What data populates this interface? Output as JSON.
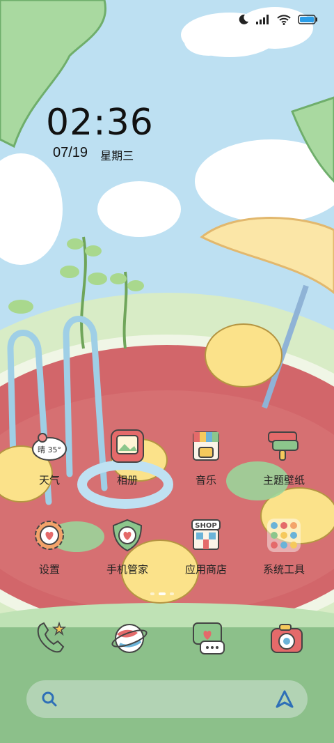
{
  "status_bar": {
    "icons": [
      "moon-icon",
      "signal-icon",
      "wifi-icon",
      "battery-icon"
    ]
  },
  "clock": {
    "time": "02:36",
    "date": "07/19",
    "weekday": "星期三"
  },
  "weather_widget": {
    "text": "晴 35°"
  },
  "apps": [
    {
      "name": "天气",
      "icon": "weather-icon"
    },
    {
      "name": "相册",
      "icon": "gallery-icon"
    },
    {
      "name": "音乐",
      "icon": "music-icon"
    },
    {
      "name": "主题壁纸",
      "icon": "theme-icon"
    },
    {
      "name": "设置",
      "icon": "settings-icon"
    },
    {
      "name": "手机管家",
      "icon": "security-icon"
    },
    {
      "name": "应用商店",
      "icon": "app-store-icon"
    },
    {
      "name": "系统工具",
      "icon": "folder-icon"
    }
  ],
  "app_store_badge": "SHOP",
  "dock": [
    "phone-icon",
    "browser-icon",
    "messages-icon",
    "camera-icon"
  ],
  "page_indicator": {
    "pages": 3,
    "current": 2
  },
  "search_bar": {
    "left_icon": "search-icon",
    "right_icon": "assistant-icon"
  }
}
